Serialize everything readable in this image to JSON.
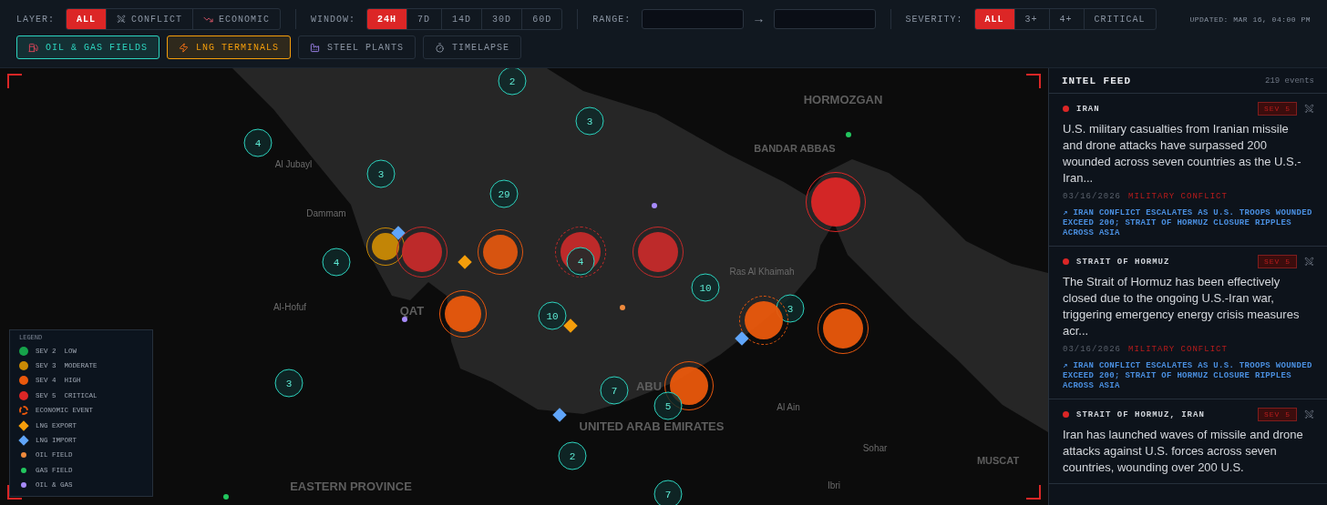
{
  "toolbar": {
    "layer": {
      "label": "LAYER:",
      "options": [
        {
          "label": "ALL",
          "kind": "plain",
          "selected": true
        },
        {
          "label": "CONFLICT",
          "kind": "conflict",
          "selected": false
        },
        {
          "label": "ECONOMIC",
          "kind": "economic",
          "selected": false
        }
      ]
    },
    "window": {
      "label": "WINDOW:",
      "options": [
        {
          "label": "24H",
          "selected": true
        },
        {
          "label": "7D",
          "selected": false
        },
        {
          "label": "14D",
          "selected": false
        },
        {
          "label": "30D",
          "selected": false
        },
        {
          "label": "60D",
          "selected": false
        }
      ]
    },
    "range": {
      "label": "RANGE:",
      "arrow": "→"
    },
    "severity": {
      "label": "SEVERITY:",
      "options": [
        {
          "label": "ALL",
          "selected": true
        },
        {
          "label": "3+",
          "selected": false
        },
        {
          "label": "4+",
          "selected": false
        },
        {
          "label": "CRITICAL",
          "selected": false
        }
      ]
    },
    "updated": "UPDATED: MAR 16, 04:00 PM",
    "toggles": [
      {
        "label": "OIL & GAS FIELDS",
        "kind": "fuel",
        "on": true
      },
      {
        "label": "LNG TERMINALS",
        "kind": "lng",
        "on": true
      },
      {
        "label": "STEEL PLANTS",
        "kind": "steel",
        "on": false
      },
      {
        "label": "TIMELAPSE",
        "kind": "time",
        "on": false
      }
    ]
  },
  "map": {
    "places": [
      {
        "label": "HORMOZGAN",
        "kind": "region"
      },
      {
        "label": "BANDAR ABBAS",
        "kind": "city"
      },
      {
        "label": "Al Jubayl",
        "kind": "town"
      },
      {
        "label": "Dammam",
        "kind": "town"
      },
      {
        "label": "Ras Al Khaimah",
        "kind": "town"
      },
      {
        "label": "Al-Hofuf",
        "kind": "town"
      },
      {
        "label": "QAT",
        "kind": "region"
      },
      {
        "label": "ABU",
        "kind": "region"
      },
      {
        "label": "UNITED ARAB EMIRATES",
        "kind": "region"
      },
      {
        "label": "Al Ain",
        "kind": "town"
      },
      {
        "label": "Sohar",
        "kind": "town"
      },
      {
        "label": "MUSCAT",
        "kind": "city"
      },
      {
        "label": "Ibri",
        "kind": "town"
      },
      {
        "label": "EASTERN PROVINCE",
        "kind": "region"
      }
    ],
    "markers": [
      {
        "kind": "cluster",
        "count": "2"
      },
      {
        "kind": "cluster",
        "count": "3"
      },
      {
        "kind": "cluster",
        "count": "4"
      },
      {
        "kind": "cluster",
        "count": "3"
      },
      {
        "kind": "cluster",
        "count": "29"
      },
      {
        "kind": "cluster",
        "count": "4"
      },
      {
        "kind": "cluster",
        "count": "10"
      },
      {
        "kind": "cluster",
        "count": "10"
      },
      {
        "kind": "cluster",
        "count": "3"
      },
      {
        "kind": "cluster",
        "count": "3"
      },
      {
        "kind": "cluster",
        "count": "7"
      },
      {
        "kind": "cluster",
        "count": "2"
      },
      {
        "kind": "cluster",
        "count": "7"
      },
      {
        "kind": "event",
        "color": "#ca8a04",
        "economic": false
      },
      {
        "kind": "event",
        "color": "#c52a2a",
        "economic": false
      },
      {
        "kind": "event",
        "color": "#e0560f",
        "economic": false
      },
      {
        "kind": "event",
        "color": "#c52a2a",
        "economic": true
      },
      {
        "kind": "event",
        "color": "#c52a2a",
        "economic": false
      },
      {
        "kind": "event",
        "color": "#dc2626",
        "economic": false
      },
      {
        "kind": "event",
        "color": "#ea580c",
        "economic": false
      },
      {
        "kind": "event",
        "color": "#ea580c",
        "economic": true
      },
      {
        "kind": "event",
        "color": "#ea580c",
        "economic": false
      },
      {
        "kind": "event",
        "color": "#ea580c",
        "economic": false
      },
      {
        "kind": "cluster",
        "count": "4"
      },
      {
        "kind": "cluster",
        "count": "5"
      },
      {
        "kind": "lng_export"
      },
      {
        "kind": "lng_export"
      },
      {
        "kind": "lng_import"
      },
      {
        "kind": "lng_import"
      },
      {
        "kind": "lng_import"
      },
      {
        "kind": "dot",
        "color": "#f08a3c"
      },
      {
        "kind": "dot",
        "color": "#22c55e"
      },
      {
        "kind": "dot",
        "color": "#22c55e"
      },
      {
        "kind": "dot",
        "color": "#a78bfa"
      },
      {
        "kind": "dot",
        "color": "#a78bfa"
      }
    ],
    "legend": {
      "title": "LEGEND",
      "items": [
        {
          "label": "SEV 2  LOW",
          "kind": "sev",
          "color": "#16a34a"
        },
        {
          "label": "SEV 3  MODERATE",
          "kind": "sev",
          "color": "#ca8a04"
        },
        {
          "label": "SEV 4  HIGH",
          "kind": "sev",
          "color": "#ea580c"
        },
        {
          "label": "SEV 5  CRITICAL",
          "kind": "sev",
          "color": "#dc2626"
        },
        {
          "label": "ECONOMIC EVENT",
          "kind": "ring",
          "color": "#ea580c"
        },
        {
          "label": "LNG EXPORT",
          "kind": "diamond",
          "color": "#f59e0b"
        },
        {
          "label": "LNG IMPORT",
          "kind": "diamond",
          "color": "#60a5fa"
        },
        {
          "label": "OIL FIELD",
          "kind": "dot",
          "color": "#f08a3c"
        },
        {
          "label": "GAS FIELD",
          "kind": "dot",
          "color": "#22c55e"
        },
        {
          "label": "OIL & GAS",
          "kind": "dot",
          "color": "#a78bfa"
        }
      ]
    }
  },
  "feed": {
    "title": "INTEL FEED",
    "count": "219 events",
    "items": [
      {
        "location": "IRAN",
        "severity": "SEV 5",
        "text": "U.S. military casualties from Iranian missile and drone attacks have surpassed 200 wounded across seven countries as the U.S.-Iran...",
        "date": "03/16/2026",
        "category": "MILITARY CONFLICT",
        "headline": "↗ IRAN CONFLICT ESCALATES AS U.S. TROOPS WOUNDED EXCEED 200; STRAIT OF HORMUZ CLOSURE RIPPLES ACROSS ASIA"
      },
      {
        "location": "STRAIT OF HORMUZ",
        "severity": "SEV 5",
        "text": "The Strait of Hormuz has been effectively closed due to the ongoing U.S.-Iran war, triggering emergency energy crisis measures acr...",
        "date": "03/16/2026",
        "category": "MILITARY CONFLICT",
        "headline": "↗ IRAN CONFLICT ESCALATES AS U.S. TROOPS WOUNDED EXCEED 200; STRAIT OF HORMUZ CLOSURE RIPPLES ACROSS ASIA"
      },
      {
        "location": "STRAIT OF HORMUZ, IRAN",
        "severity": "SEV 5",
        "text": "Iran has launched waves of missile and drone attacks against U.S. forces across seven countries, wounding over 200 U.S."
      }
    ]
  }
}
